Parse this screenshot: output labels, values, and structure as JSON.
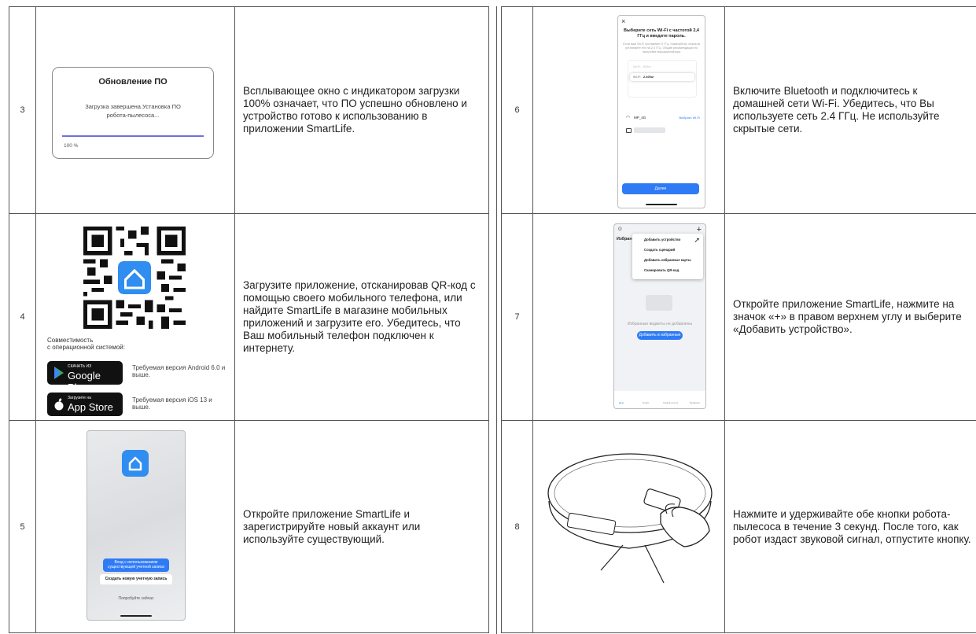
{
  "left_rows": [
    {
      "num": "3",
      "text": "Всплывающее окно с индикатором загрузки 100% означает, что ПО успешно обновлено и  устройство готово к использованию в приложении SmartLife."
    },
    {
      "num": "4",
      "text": "Загрузите приложение, отсканировав QR-код с помощью своего мобильного телефона, или найдите SmartLife в магазине мобильных приложений и загрузите его. Убедитесь, что Ваш мобильный телефон подключен к интернету."
    },
    {
      "num": "5",
      "text": "Откройте приложение SmartLife и зарегистрируйте новый аккаунт или используйте существующий."
    }
  ],
  "right_rows": [
    {
      "num": "6",
      "text": "Включите Bluetooth и подключитесь к домашней сети Wi-Fi. Убедитесь, что Вы используете сеть 2.4 ГГц. Не используйте скрытые сети."
    },
    {
      "num": "7",
      "text": "Откройте приложение SmartLife, нажмите на значок «+» в правом верхнем углу и выберите «Добавить устройство»."
    },
    {
      "num": "8",
      "text": "Нажмите и удерживайте обе кнопки робота-пылесоса в течение 3 секунд. После того, как робот издаст звуковой сигнал, отпустите кнопку."
    }
  ],
  "update_popup": {
    "title": "Обновление ПО",
    "message": "Загрузка завершена.Установка ПО робота-пылесоса...",
    "progress_label": "100 %",
    "progress": 1.0
  },
  "qr_block": {
    "compat": "Совместимость\nс операционной системой:",
    "google": {
      "small": "СКАЧАТЬ ИЗ",
      "big": "Google Play",
      "req": "Требуемая версия Android 6.0 и выше."
    },
    "apple": {
      "small": "Загрузите на",
      "big": "App Store",
      "req": "Требуемая версия iOS 13 и выше."
    }
  },
  "login_screen": {
    "login_btn": "Вход с использованием существующей учетной записи",
    "create_btn": "Создать новую учетную запись",
    "try_link": "Попробуйте сейчас"
  },
  "wifi_screen": {
    "close": "×",
    "title": "Выберите сеть Wi-Fi с частотой 2,4 ГГц и введите пароль.",
    "hint": "Если ваш Wi-Fi составляет 5 ГГц, пожалуйста, сначала установите его на 2,4 ГГц. Общие рекомендации по настройке маршрутизатора",
    "row1": "Wi-Fi - 5Ghz",
    "row2_a": "Wi-Fi - ",
    "row2_b": "2.4Ghz",
    "network": "MP_4G",
    "choose": "Выбрать Wi-Fi",
    "next": "Далее"
  },
  "add_screen": {
    "favorites": "Избранное",
    "menu": [
      "Добавить устройство",
      "Создать сценарий",
      "Добавить избранные карты",
      "Сканировать QR-код"
    ],
    "empty": "Избранные виджеты не добавлены",
    "add_fav": "Добавить в избранные",
    "tabs": [
      "Дом",
      "Smart",
      "Умный уголок",
      "Профиль"
    ]
  },
  "colors": {
    "accent": "#2f7bf6",
    "border": "#555555",
    "progress": "#6e72d8"
  }
}
